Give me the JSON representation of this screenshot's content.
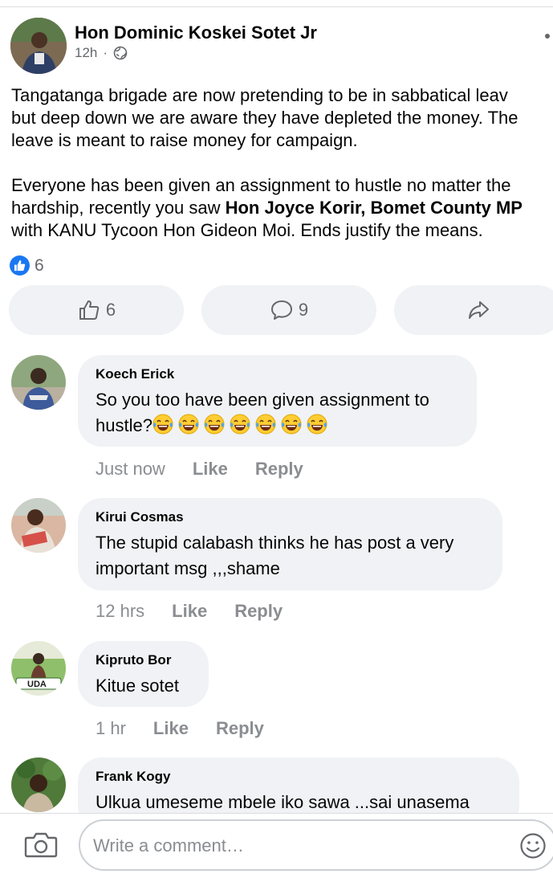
{
  "post": {
    "author": "Hon Dominic Koskei Sotet Jr",
    "time": "12h",
    "separator": "·",
    "paragraphs": [
      [
        "Tangatanga brigade are now pretending to be in sabbatical leav",
        "but deep down we are aware they have depleted the money. The",
        "leave is meant to raise money for campaign."
      ],
      [
        "Everyone has been given an assignment to hustle no matter the",
        "hardship, recently you saw "
      ]
    ],
    "bold_mention": "Hon Joyce Korir, Bomet County MP",
    "last_line": "with KANU Tycoon Hon Gideon Moi. Ends justify the means.",
    "reaction_count": "6",
    "like_count": "6",
    "comment_count": "9"
  },
  "comments": [
    {
      "name": "Koech Erick",
      "text_line1": "So you too have been given assignment to",
      "text_line2": "hustle?",
      "emoji_count": 7,
      "time": "Just now",
      "like": "Like",
      "reply": "Reply"
    },
    {
      "name": "Kirui Cosmas",
      "text_line1": "The stupid calabash thinks he has post a very",
      "text_line2": "important msg ,,,shame",
      "time": "12 hrs",
      "like": "Like",
      "reply": "Reply"
    },
    {
      "name": "Kipruto Bor",
      "text_line1": "Kitue sotet",
      "avatar_text": "UDA",
      "time": "1 hr",
      "like": "Like",
      "reply": "Reply"
    },
    {
      "name": "Frank Kogy",
      "text_line1": "Ulkua umeseme mbele iko sawa ...sai unasema"
    }
  ],
  "composer": {
    "placeholder": "Write a comment…"
  },
  "colors": {
    "accent": "#1877f2",
    "bubble": "#f0f2f5",
    "secondary_text": "#65676b",
    "meta_text": "#8a8d91"
  }
}
